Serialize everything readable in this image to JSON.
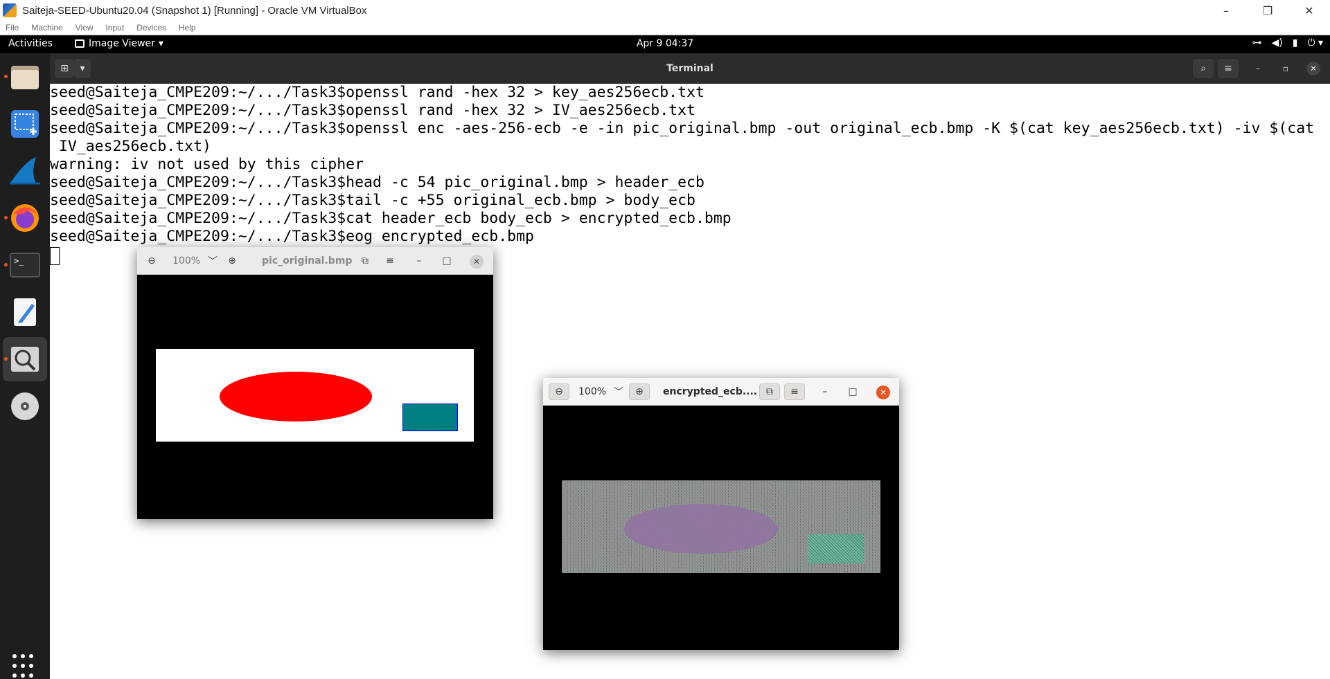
{
  "vbox": {
    "title": "Saiteja-SEED-Ubuntu20.04 (Snapshot 1) [Running] - Oracle VM VirtualBox",
    "menu": [
      "File",
      "Machine",
      "View",
      "Input",
      "Devices",
      "Help"
    ],
    "controls": {
      "minimize": "–",
      "restore": "❐",
      "close": "✕"
    }
  },
  "topbar": {
    "activities": "Activities",
    "app_name": "Image Viewer",
    "app_menu_arrow": "▾",
    "clock": "Apr 9  04:37",
    "status_icons": [
      "network-icon",
      "volume-icon",
      "battery-icon",
      "power-icon"
    ],
    "status_glyphs": {
      "network": "⊶",
      "volume": "◀)",
      "battery": "▮",
      "power": "⏻ ▾"
    }
  },
  "dock": {
    "items": [
      {
        "name": "files",
        "icon": "folder-icon"
      },
      {
        "name": "screenshot",
        "icon": "screenshot-icon"
      },
      {
        "name": "wireshark",
        "icon": "wireshark-icon"
      },
      {
        "name": "firefox",
        "icon": "firefox-icon"
      },
      {
        "name": "terminal",
        "icon": "terminal-icon"
      },
      {
        "name": "text-editor",
        "icon": "text-editor-icon"
      },
      {
        "name": "image-viewer",
        "icon": "image-viewer-icon"
      },
      {
        "name": "disc",
        "icon": "disc-icon"
      }
    ],
    "terminal_glyph": ">_"
  },
  "terminal": {
    "title": "Terminal",
    "glyphs": {
      "new_tab": "⊞",
      "dropdown": "▾",
      "search": "⌕",
      "menu": "≡",
      "minimize": "–",
      "maximize": "▫",
      "close": "✕"
    },
    "lines": [
      "seed@Saiteja_CMPE209:~/.../Task3$openssl rand -hex 32 > key_aes256ecb.txt",
      "seed@Saiteja_CMPE209:~/.../Task3$openssl rand -hex 32 > IV_aes256ecb.txt",
      "seed@Saiteja_CMPE209:~/.../Task3$openssl enc -aes-256-ecb -e -in pic_original.bmp -out original_ecb.bmp -K $(cat key_aes256ecb.txt) -iv $(cat",
      " IV_aes256ecb.txt)",
      "warning: iv not used by this cipher",
      "seed@Saiteja_CMPE209:~/.../Task3$head -c 54 pic_original.bmp > header_ecb",
      "seed@Saiteja_CMPE209:~/.../Task3$tail -c +55 original_ecb.bmp > body_ecb",
      "seed@Saiteja_CMPE209:~/.../Task3$cat header_ecb body_ecb > encrypted_ecb.bmp",
      "seed@Saiteja_CMPE209:~/.../Task3$eog encrypted_ecb.bmp"
    ]
  },
  "viewer_original": {
    "title": "pic_original.bmp",
    "zoom": "100%",
    "glyphs": {
      "zoom_out": "⊖",
      "zoom_dropdown": "﹀",
      "zoom_in": "⊕",
      "gallery": "⧉",
      "menu": "≡",
      "minimize": "–",
      "maximize": "□",
      "close": "✕"
    },
    "colors": {
      "background": "#ffffff",
      "ellipse": "#ff0000",
      "rect": "#008080",
      "rect_border": "#0000ff"
    }
  },
  "viewer_encrypted": {
    "title": "encrypted_ecb....",
    "zoom": "100%",
    "glyphs": {
      "zoom_out": "⊖",
      "zoom_dropdown": "﹀",
      "zoom_in": "⊕",
      "gallery": "⧉",
      "menu": "≡",
      "minimize": "–",
      "maximize": "□",
      "close": "✕"
    },
    "close_color": "#e95420"
  }
}
